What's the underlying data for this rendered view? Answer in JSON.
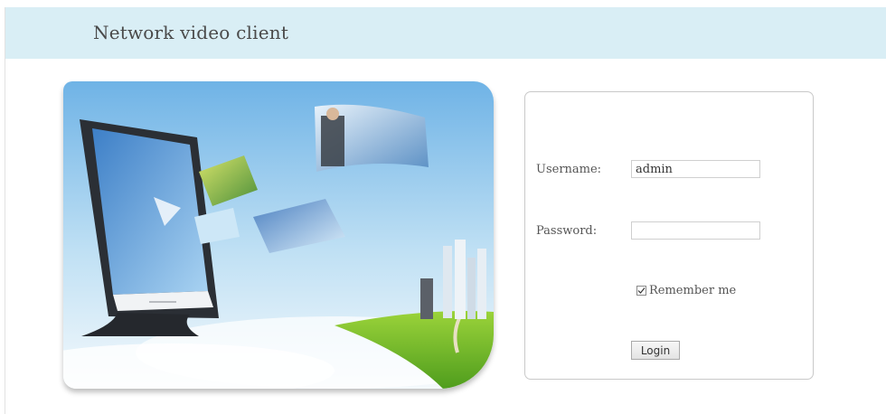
{
  "header": {
    "title": "Network video client"
  },
  "login": {
    "username_label": "Username:",
    "username_value": "admin",
    "password_label": "Password:",
    "password_value": "",
    "remember_label": "Remember me",
    "remember_checked": true,
    "login_button_label": "Login"
  },
  "hero": {
    "description_icon": "monitor-with-flying-photos-illustration"
  },
  "colors": {
    "header_bg": "#d9eef5",
    "panel_border": "#c9c9c9"
  }
}
